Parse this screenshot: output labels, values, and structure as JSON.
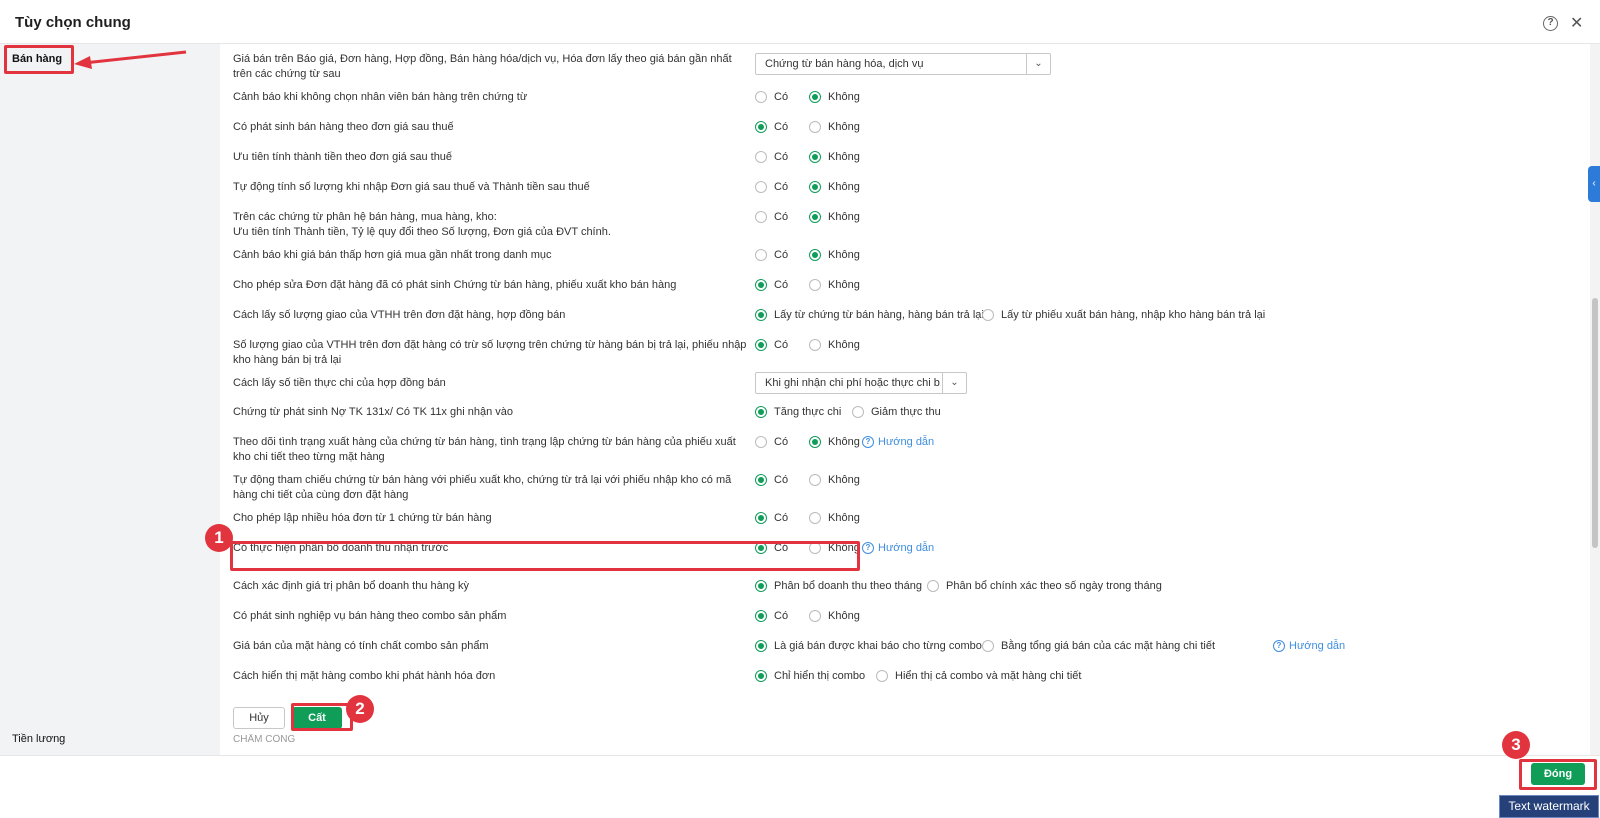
{
  "dialog": {
    "title": "Tùy chọn chung"
  },
  "sidebar": {
    "items": [
      {
        "label": "Bán hàng"
      },
      {
        "label": "Tiền lương"
      }
    ]
  },
  "settings": [
    {
      "label": "Giá bán trên Báo giá, Đơn hàng, Hợp đồng, Bán hàng hóa/dịch vụ, Hóa đơn lấy theo giá bán gần nhất trên các chứng từ sau",
      "select": "Chứng từ bán hàng hóa, dịch vụ"
    },
    {
      "label": "Cảnh báo khi không chọn nhân viên bán hàng trên chứng từ",
      "options": [
        {
          "label": "Có",
          "checked": false
        },
        {
          "label": "Không",
          "checked": true
        }
      ]
    },
    {
      "label": "Có phát sinh bán hàng theo đơn giá sau thuế",
      "options": [
        {
          "label": "Có",
          "checked": true
        },
        {
          "label": "Không",
          "checked": false
        }
      ]
    },
    {
      "label": "Ưu tiên tính thành tiền theo đơn giá sau thuế",
      "options": [
        {
          "label": "Có",
          "checked": false
        },
        {
          "label": "Không",
          "checked": true
        }
      ]
    },
    {
      "label": "Tự động tính số lượng khi nhập Đơn giá sau thuế và Thành tiền sau thuế",
      "options": [
        {
          "label": "Có",
          "checked": false
        },
        {
          "label": "Không",
          "checked": true
        }
      ]
    },
    {
      "label": "Trên các chứng từ phân hệ bán hàng, mua hàng, kho:",
      "label2": "Ưu tiên tính Thành tiền, Tỷ lệ quy đổi theo Số lượng, Đơn giá của ĐVT chính.",
      "options": [
        {
          "label": "Có",
          "checked": false
        },
        {
          "label": "Không",
          "checked": true
        }
      ]
    },
    {
      "label": "Cảnh báo khi giá bán thấp hơn giá mua gần nhất trong danh mục",
      "options": [
        {
          "label": "Có",
          "checked": false
        },
        {
          "label": "Không",
          "checked": true
        }
      ]
    },
    {
      "label": "Cho phép sửa Đơn đặt hàng đã có phát sinh Chứng từ bán hàng, phiếu xuất kho bán hàng",
      "options": [
        {
          "label": "Có",
          "checked": true
        },
        {
          "label": "Không",
          "checked": false
        }
      ]
    },
    {
      "label": "Cách lấy số lượng giao của VTHH trên đơn đặt hàng, hợp đồng bán",
      "options": [
        {
          "label": "Lấy từ chứng từ bán hàng, hàng bán trả lại",
          "checked": true
        },
        {
          "label": "Lấy từ phiếu xuất bán hàng, nhập kho hàng bán trả lại",
          "checked": false
        }
      ]
    },
    {
      "label": "Số lượng giao của VTHH trên đơn đặt hàng có trừ số lượng trên chứng từ hàng bán bị trả lại, phiếu nhập kho hàng bán bị trả lại",
      "options": [
        {
          "label": "Có",
          "checked": true
        },
        {
          "label": "Không",
          "checked": false
        }
      ]
    },
    {
      "label": "Cách lấy số tiền thực chi của hợp đồng bán",
      "select": "Khi ghi nhận chi phí hoặc thực chi b..."
    },
    {
      "label": "Chứng từ phát sinh Nợ TK 131x/ Có TK 11x ghi nhận vào",
      "options": [
        {
          "label": "Tăng thực chi",
          "checked": true
        },
        {
          "label": "Giảm thực thu",
          "checked": false
        }
      ]
    },
    {
      "label": "Theo dõi tình trạng xuất hàng của chứng từ bán hàng, tình trạng lập chứng từ bán hàng của phiếu xuất kho chi tiết theo từng mặt hàng",
      "options": [
        {
          "label": "Có",
          "checked": false
        },
        {
          "label": "Không",
          "checked": true
        }
      ],
      "guide": "Hướng dẫn"
    },
    {
      "label": "Tự động tham chiếu chứng từ bán hàng với phiếu xuất kho, chứng từ trả lại với phiếu nhập kho có mã hàng chi tiết của cùng đơn đặt hàng",
      "options": [
        {
          "label": "Có",
          "checked": true
        },
        {
          "label": "Không",
          "checked": false
        }
      ]
    },
    {
      "label": "Cho phép lập nhiều hóa đơn từ 1 chứng từ bán hàng",
      "options": [
        {
          "label": "Có",
          "checked": true
        },
        {
          "label": "Không",
          "checked": false
        }
      ]
    },
    {
      "label": "Có thực hiện phân bổ doanh thu nhận trước",
      "options": [
        {
          "label": "Có",
          "checked": true
        },
        {
          "label": "Không",
          "checked": false
        }
      ],
      "guide": "Hướng dẫn"
    },
    {
      "label": "Cách xác định giá trị phân bổ doanh thu hàng kỳ",
      "options": [
        {
          "label": "Phân bổ doanh thu theo tháng",
          "checked": true
        },
        {
          "label": "Phân bổ chính xác theo số ngày trong tháng",
          "checked": false
        }
      ]
    },
    {
      "label": "Có phát sinh nghiệp vụ bán hàng theo combo sản phẩm",
      "options": [
        {
          "label": "Có",
          "checked": true
        },
        {
          "label": "Không",
          "checked": false
        }
      ]
    },
    {
      "label": "Giá bán của mặt hàng có tính chất combo sản phẩm",
      "options": [
        {
          "label": "Là giá bán được khai báo cho từng combo",
          "checked": true
        },
        {
          "label": "Bằng tổng giá bán của các mặt hàng chi tiết",
          "checked": false
        }
      ],
      "guide": "Hướng dẫn"
    },
    {
      "label": "Cách hiển thị mặt hàng combo khi phát hành hóa đơn",
      "options": [
        {
          "label": "Chỉ hiển thị combo",
          "checked": true
        },
        {
          "label": "Hiển thị cả combo và mặt hàng chi tiết",
          "checked": false
        }
      ]
    }
  ],
  "actions": {
    "cancel": "Hủy",
    "save": "Cất",
    "close": "Đóng"
  },
  "next_section": "CHẤM CÔNG",
  "watermark": "Text watermark",
  "annotations": [
    "1",
    "2",
    "3"
  ]
}
